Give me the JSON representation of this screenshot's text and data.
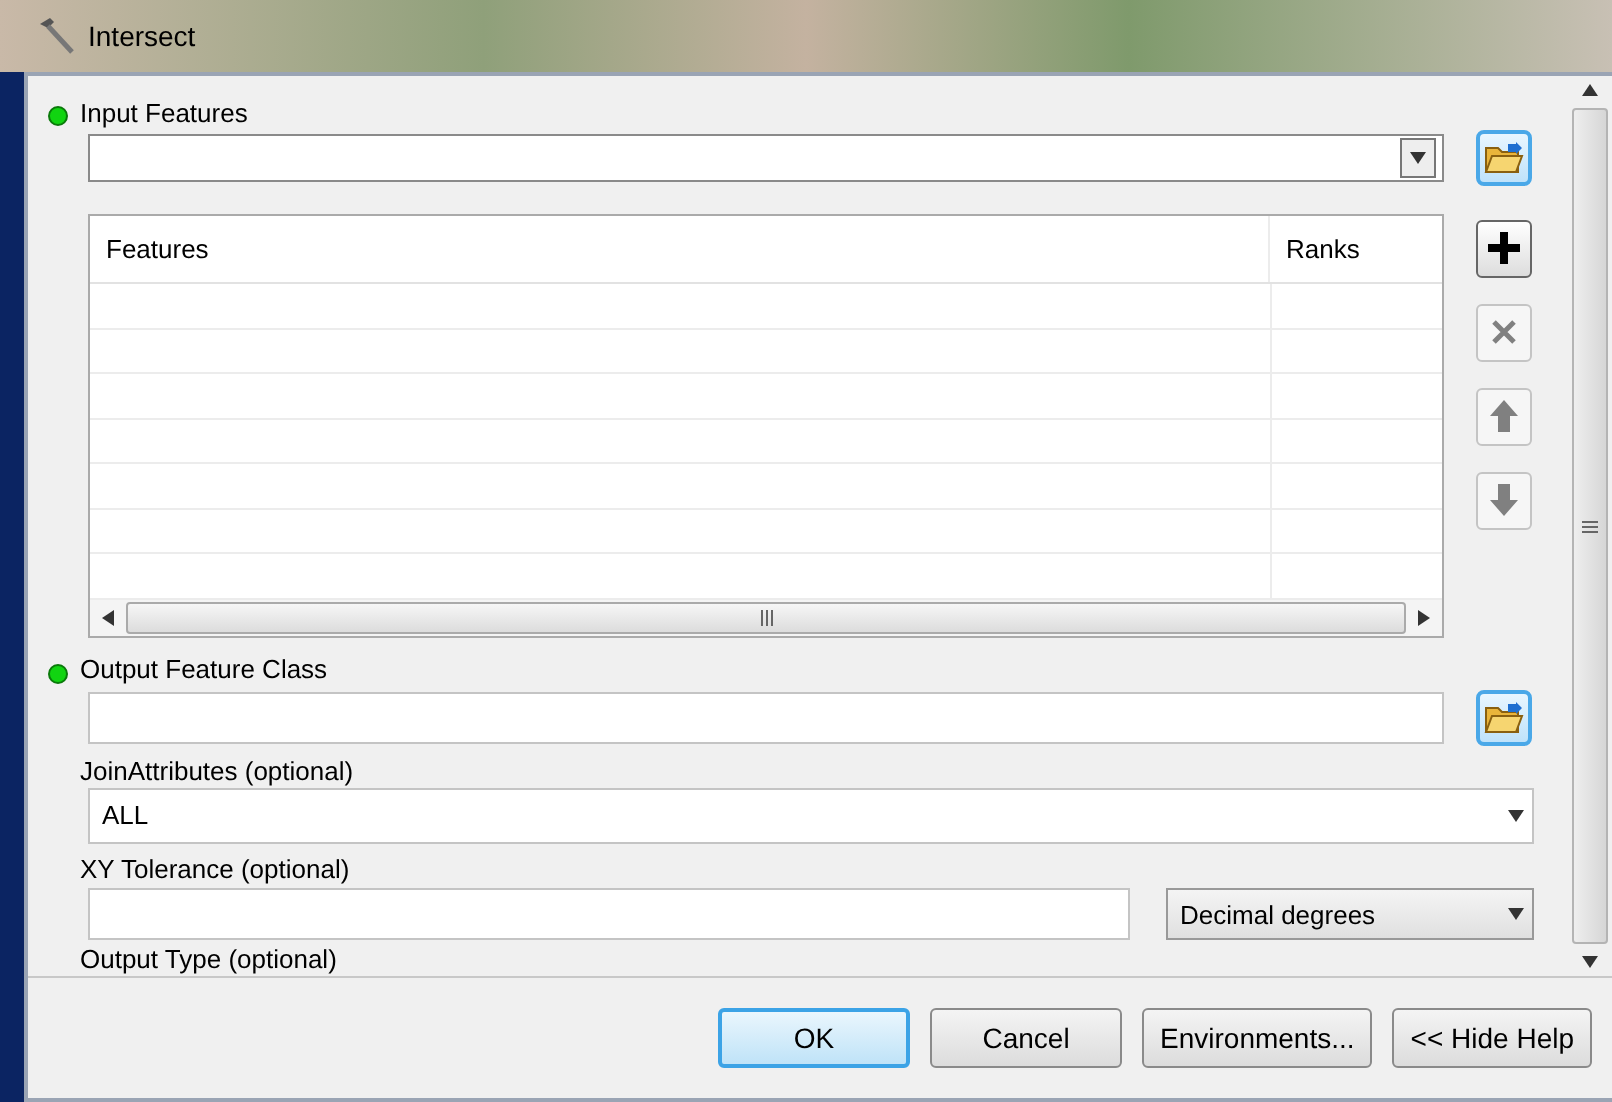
{
  "window": {
    "title": "Intersect"
  },
  "input_features": {
    "label": "Input Features",
    "required": true
  },
  "features_table": {
    "columns": [
      "Features",
      "Ranks"
    ]
  },
  "list_buttons": [
    {
      "kind": "add",
      "disabled": false
    },
    {
      "kind": "remove",
      "disabled": true
    },
    {
      "kind": "up",
      "disabled": true
    },
    {
      "kind": "down",
      "disabled": true
    }
  ],
  "output_feature_class": {
    "label": "Output Feature Class",
    "required": true
  },
  "join_attributes": {
    "label": "JoinAttributes (optional)",
    "value": "ALL"
  },
  "xy_tolerance": {
    "label": "XY Tolerance (optional)",
    "unit": "Decimal degrees"
  },
  "output_type": {
    "label": "Output Type (optional)"
  },
  "buttons": [
    {
      "label": "OK",
      "default": true
    },
    {
      "label": "Cancel",
      "default": false
    },
    {
      "label": "Environments...",
      "default": false
    },
    {
      "label": "<< Hide Help",
      "default": false
    }
  ]
}
